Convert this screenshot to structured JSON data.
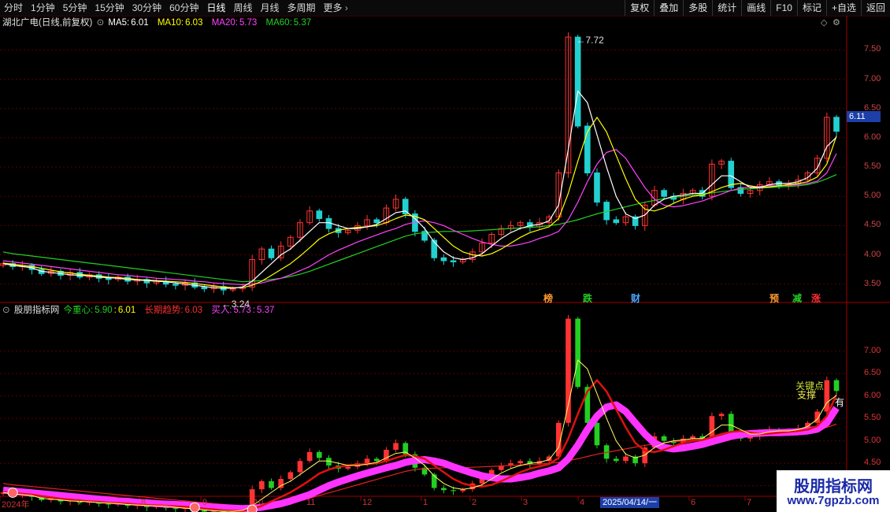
{
  "toolbar": {
    "timeframes": [
      "分时",
      "1分钟",
      "5分钟",
      "15分钟",
      "30分钟",
      "60分钟",
      "日线",
      "周线",
      "月线",
      "多周期",
      "更多"
    ],
    "active": "日线",
    "right_buttons": [
      "复权",
      "叠加",
      "多股",
      "统计",
      "画线",
      "F10",
      "标记",
      "+自选",
      "返回"
    ]
  },
  "main_legend": {
    "stock": "湖北广电(日线,前复权)",
    "ma5_label": "MA5:",
    "ma5": "6.01",
    "ma10_label": "MA10:",
    "ma10": "6.03",
    "ma20_label": "MA20:",
    "ma20": "5.73",
    "ma60_label": "MA60:",
    "ma60": "5.37"
  },
  "sub_legend": {
    "name": "股朋指标网",
    "center_label": "今重心:",
    "center_a": "5.90",
    "center_sep": ":",
    "center_b": "6.01",
    "trend_label": "长期趋势:",
    "trend": "6.03",
    "buy_label": "买入:",
    "buy_a": "5.73",
    "buy_sep": ":",
    "buy_b": "5.37"
  },
  "current_price_tag": "6.11",
  "max_label": "7.72",
  "min_label": "3.24",
  "events": [
    {
      "text": "榜",
      "color": "#ff9a2e"
    },
    {
      "text": "跌",
      "color": "#22d022"
    },
    {
      "text": "财",
      "color": "#4aa8ff"
    },
    {
      "text": "预",
      "color": "#ff9a2e"
    },
    {
      "text": "减",
      "color": "#22d022"
    },
    {
      "text": "涨",
      "color": "#ff3030"
    }
  ],
  "sub_annotations": {
    "key_point": "关键点",
    "support": "支撑",
    "profit": "有"
  },
  "dates": [
    "2024年",
    "7",
    "8",
    "9",
    "10",
    "11",
    "12",
    "1",
    "2",
    "3",
    "4",
    "5",
    "6",
    "7"
  ],
  "date_selected": "2025/04/14/一",
  "watermark": {
    "line1": "股朋指标网",
    "line2": "www.7gpzb.com"
  },
  "colors": {
    "ma5": "#ffffff",
    "ma10": "#ffff00",
    "ma20": "#ff44ff",
    "ma60": "#22d022",
    "up": "#ff3333",
    "down": "#22d0d0",
    "grid": "#5a0000"
  },
  "chart_data": {
    "type": "line",
    "title": "湖北广电(日线,前复权)",
    "main_y_ticks": [
      3.5,
      4.0,
      4.5,
      5.0,
      5.5,
      6.0,
      6.5,
      7.0,
      7.5
    ],
    "sub_y_ticks": [
      4.0,
      4.5,
      5.0,
      5.5,
      6.0,
      6.5,
      7.0
    ],
    "main_ylim": [
      3.2,
      7.95
    ],
    "sub_ylim": [
      3.8,
      7.8
    ],
    "categories": [
      "2024年",
      "7",
      "8",
      "9",
      "10",
      "11",
      "12",
      "1",
      "2",
      "3",
      "4",
      "5",
      "6",
      "7"
    ],
    "close": [
      3.85,
      3.8,
      3.82,
      3.75,
      3.68,
      3.72,
      3.65,
      3.7,
      3.62,
      3.66,
      3.6,
      3.58,
      3.62,
      3.55,
      3.58,
      3.52,
      3.55,
      3.5,
      3.48,
      3.52,
      3.45,
      3.42,
      3.46,
      3.4,
      3.42,
      3.45,
      3.92,
      4.1,
      3.95,
      4.15,
      4.3,
      4.55,
      4.75,
      4.62,
      4.45,
      4.38,
      4.42,
      4.5,
      4.6,
      4.55,
      4.8,
      4.95,
      4.7,
      4.4,
      4.25,
      3.95,
      3.9,
      3.88,
      3.92,
      4.05,
      4.2,
      4.35,
      4.45,
      4.5,
      4.55,
      4.48,
      4.55,
      4.65,
      5.4,
      7.72,
      6.2,
      5.4,
      4.9,
      4.6,
      4.55,
      4.65,
      4.5,
      4.85,
      5.1,
      5.0,
      4.95,
      5.05,
      5.1,
      5.0,
      5.55,
      5.6,
      5.15,
      5.05,
      5.1,
      5.2,
      5.25,
      5.18,
      5.22,
      5.28,
      5.4,
      5.65,
      6.35,
      6.11
    ],
    "ma5": [
      3.85,
      3.82,
      3.8,
      3.78,
      3.72,
      3.7,
      3.68,
      3.66,
      3.65,
      3.64,
      3.62,
      3.61,
      3.6,
      3.58,
      3.57,
      3.56,
      3.55,
      3.54,
      3.52,
      3.5,
      3.48,
      3.46,
      3.44,
      3.43,
      3.43,
      3.45,
      3.55,
      3.7,
      3.85,
      4.0,
      4.1,
      4.25,
      4.4,
      4.55,
      4.55,
      4.5,
      4.45,
      4.45,
      4.48,
      4.52,
      4.62,
      4.72,
      4.75,
      4.62,
      4.45,
      4.22,
      4.05,
      3.95,
      3.92,
      3.95,
      4.02,
      4.15,
      4.28,
      4.38,
      4.45,
      4.5,
      4.52,
      4.58,
      4.85,
      5.8,
      6.8,
      6.6,
      6.05,
      5.5,
      5.0,
      4.7,
      4.62,
      4.68,
      4.85,
      4.95,
      5.0,
      5.02,
      5.05,
      5.05,
      5.2,
      5.35,
      5.35,
      5.25,
      5.15,
      5.15,
      5.2,
      5.22,
      5.22,
      5.25,
      5.32,
      5.48,
      5.85,
      6.01
    ],
    "ma10": [
      3.86,
      3.84,
      3.82,
      3.8,
      3.77,
      3.74,
      3.71,
      3.69,
      3.67,
      3.65,
      3.64,
      3.62,
      3.61,
      3.6,
      3.58,
      3.57,
      3.56,
      3.55,
      3.54,
      3.53,
      3.51,
      3.49,
      3.47,
      3.45,
      3.44,
      3.44,
      3.48,
      3.55,
      3.65,
      3.75,
      3.85,
      3.98,
      4.12,
      4.27,
      4.36,
      4.42,
      4.45,
      4.47,
      4.48,
      4.5,
      4.55,
      4.62,
      4.68,
      4.66,
      4.6,
      4.45,
      4.3,
      4.15,
      4.05,
      4.0,
      3.98,
      4.02,
      4.1,
      4.2,
      4.3,
      4.38,
      4.43,
      4.48,
      4.62,
      5.05,
      5.6,
      6.1,
      6.35,
      6.1,
      5.7,
      5.3,
      4.95,
      4.78,
      4.75,
      4.8,
      4.88,
      4.95,
      5.0,
      5.02,
      5.08,
      5.15,
      5.2,
      5.22,
      5.18,
      5.15,
      5.16,
      5.18,
      5.2,
      5.22,
      5.25,
      5.33,
      5.55,
      6.03
    ],
    "ma20": [
      3.9,
      3.88,
      3.86,
      3.84,
      3.82,
      3.8,
      3.78,
      3.76,
      3.74,
      3.72,
      3.7,
      3.68,
      3.66,
      3.65,
      3.63,
      3.62,
      3.6,
      3.59,
      3.58,
      3.57,
      3.55,
      3.54,
      3.52,
      3.51,
      3.5,
      3.49,
      3.5,
      3.52,
      3.56,
      3.6,
      3.66,
      3.73,
      3.8,
      3.9,
      4.0,
      4.08,
      4.15,
      4.22,
      4.28,
      4.34,
      4.4,
      4.45,
      4.52,
      4.56,
      4.58,
      4.55,
      4.5,
      4.42,
      4.35,
      4.28,
      4.22,
      4.18,
      4.15,
      4.15,
      4.18,
      4.22,
      4.28,
      4.33,
      4.4,
      4.6,
      4.9,
      5.25,
      5.55,
      5.75,
      5.8,
      5.65,
      5.4,
      5.15,
      4.95,
      4.85,
      4.82,
      4.84,
      4.88,
      4.92,
      4.98,
      5.04,
      5.1,
      5.14,
      5.16,
      5.17,
      5.18,
      5.18,
      5.19,
      5.2,
      5.22,
      5.26,
      5.4,
      5.73
    ],
    "ma60": [
      4.05,
      4.02,
      4.0,
      3.98,
      3.96,
      3.94,
      3.92,
      3.9,
      3.88,
      3.86,
      3.84,
      3.82,
      3.8,
      3.78,
      3.76,
      3.74,
      3.72,
      3.7,
      3.68,
      3.66,
      3.64,
      3.62,
      3.6,
      3.58,
      3.56,
      3.54,
      3.55,
      3.56,
      3.58,
      3.6,
      3.63,
      3.67,
      3.72,
      3.78,
      3.84,
      3.9,
      3.96,
      4.02,
      4.08,
      4.14,
      4.2,
      4.26,
      4.32,
      4.36,
      4.38,
      4.39,
      4.4,
      4.4,
      4.4,
      4.41,
      4.42,
      4.43,
      4.44,
      4.45,
      4.46,
      4.47,
      4.48,
      4.5,
      4.52,
      4.56,
      4.6,
      4.65,
      4.7,
      4.74,
      4.78,
      4.82,
      4.86,
      4.9,
      4.93,
      4.96,
      4.98,
      5.0,
      5.02,
      5.04,
      5.06,
      5.08,
      5.1,
      5.12,
      5.13,
      5.14,
      5.15,
      5.16,
      5.17,
      5.18,
      5.2,
      5.24,
      5.3,
      5.37
    ]
  }
}
